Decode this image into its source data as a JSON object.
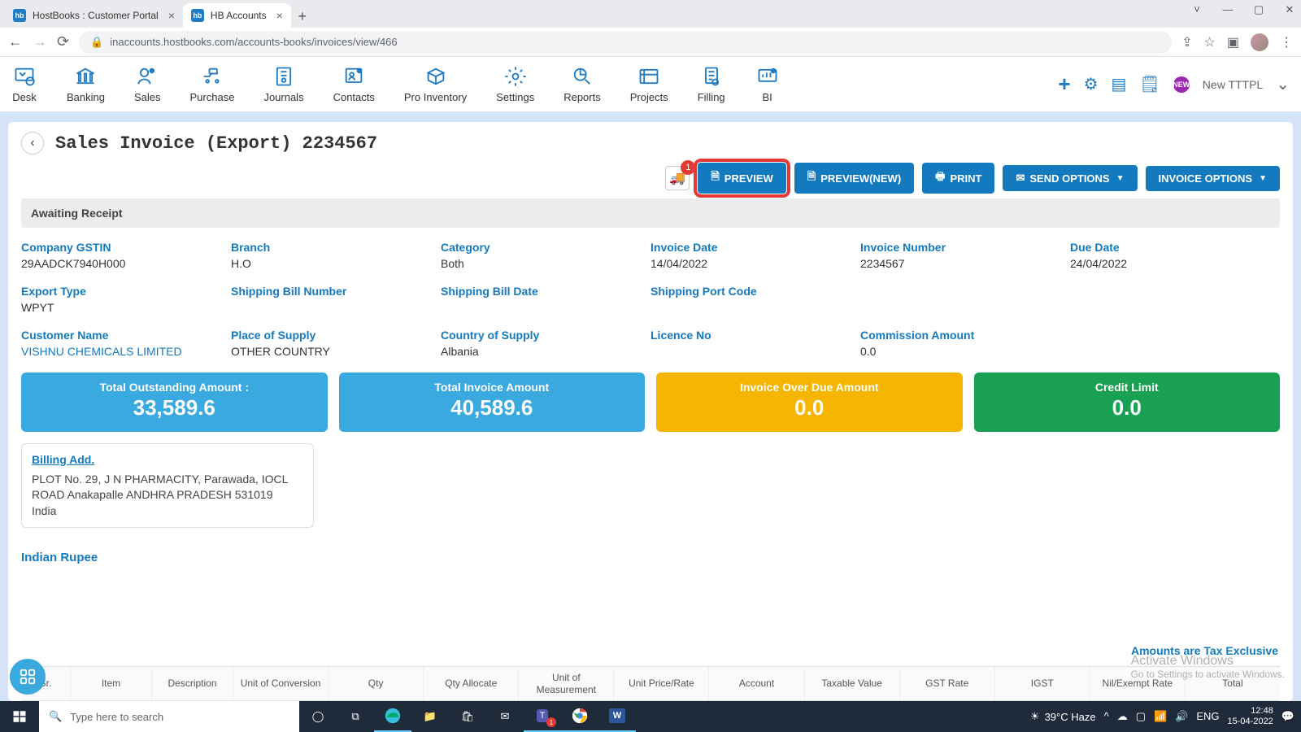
{
  "browser": {
    "tabs": [
      {
        "title": "HostBooks : Customer Portal",
        "active": false
      },
      {
        "title": "HB Accounts",
        "active": true
      }
    ],
    "url": "inaccounts.hostbooks.com/accounts-books/invoices/view/466"
  },
  "toolbar": {
    "items": [
      "Desk",
      "Banking",
      "Sales",
      "Purchase",
      "Journals",
      "Contacts",
      "Pro Inventory",
      "Settings",
      "Reports",
      "Projects",
      "Filling",
      "BI"
    ],
    "new_label": "NEW",
    "user": "New TTTPL"
  },
  "page": {
    "title": "Sales Invoice (Export) 2234567",
    "eway_badge": "1",
    "buttons": {
      "preview": "PREVIEW",
      "preview_new": "PREVIEW(NEW)",
      "print": "PRINT",
      "send": "SEND OPTIONS",
      "invoice": "INVOICE OPTIONS"
    },
    "status": "Awaiting Receipt",
    "fields": {
      "gstin": {
        "label": "Company GSTIN",
        "value": "29AADCK7940H000"
      },
      "branch": {
        "label": "Branch",
        "value": "H.O"
      },
      "category": {
        "label": "Category",
        "value": "Both"
      },
      "inv_date": {
        "label": "Invoice Date",
        "value": "14/04/2022"
      },
      "inv_no": {
        "label": "Invoice Number",
        "value": "2234567"
      },
      "due": {
        "label": "Due Date",
        "value": "24/04/2022"
      },
      "export_type": {
        "label": "Export Type",
        "value": "WPYT"
      },
      "ship_bill_no": {
        "label": "Shipping Bill Number",
        "value": ""
      },
      "ship_bill_date": {
        "label": "Shipping Bill Date",
        "value": ""
      },
      "ship_port": {
        "label": "Shipping Port Code",
        "value": ""
      },
      "customer": {
        "label": "Customer Name",
        "value": "VISHNU CHEMICALS LIMITED"
      },
      "pos": {
        "label": "Place of Supply",
        "value": "OTHER COUNTRY"
      },
      "cos": {
        "label": "Country of Supply",
        "value": "Albania"
      },
      "licence": {
        "label": "Licence No",
        "value": ""
      },
      "commission": {
        "label": "Commission Amount",
        "value": "0.0"
      }
    },
    "stats": {
      "outstanding": {
        "label": "Total Outstanding Amount :",
        "value": "33,589.6"
      },
      "invoice": {
        "label": "Total Invoice Amount",
        "value": "40,589.6"
      },
      "overdue": {
        "label": "Invoice Over Due Amount",
        "value": "0.0"
      },
      "credit": {
        "label": "Credit Limit",
        "value": "0.0"
      }
    },
    "billing": {
      "heading": "Billing Add.",
      "line1": "PLOT No. 29, J N PHARMACITY, Parawada, IOCL ROAD Anakapalle ANDHRA PRADESH 531019",
      "line2": "India"
    },
    "currency_label": "Indian Rupee",
    "tax_note": "Amounts are Tax Exclusive",
    "table_headers": [
      "Sr.",
      "Item",
      "Description",
      "Unit of Conversion",
      "Qty",
      "Qty Allocate",
      "Unit of Measurement",
      "Unit Price/Rate",
      "Account",
      "Taxable Value",
      "GST Rate",
      "IGST",
      "Nil/Exempt Rate",
      "Total"
    ]
  },
  "watermark": {
    "l1": "Activate Windows",
    "l2": "Go to Settings to activate Windows."
  },
  "taskbar": {
    "search_placeholder": "Type here to search",
    "weather": "39°C Haze",
    "lang": "ENG",
    "time": "12:48",
    "date": "15-04-2022"
  }
}
